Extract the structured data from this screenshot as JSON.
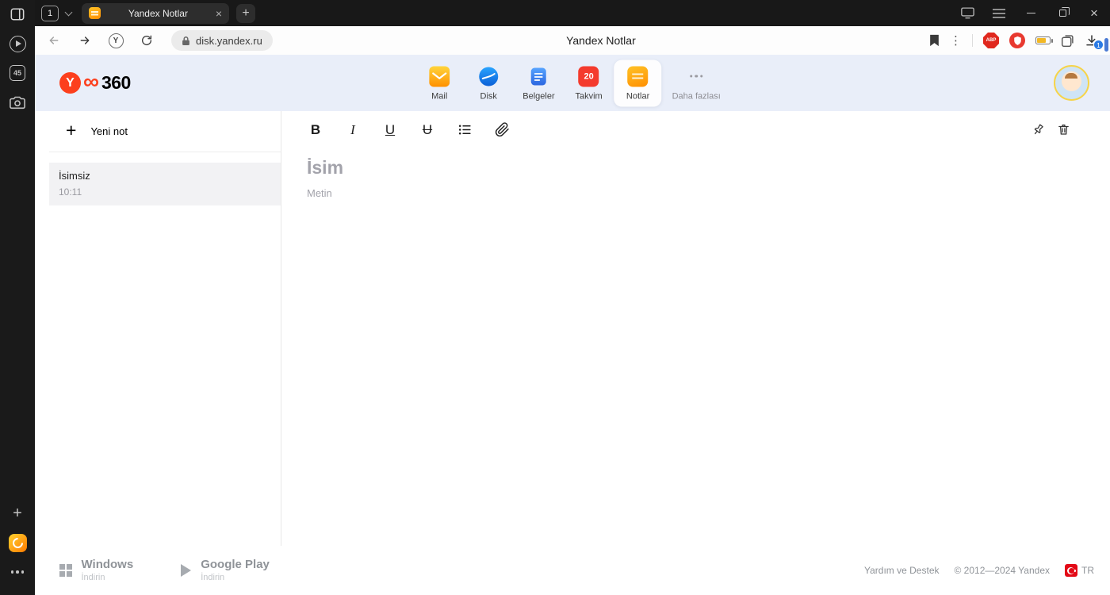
{
  "colors": {
    "yandex_red": "#fc3f1d",
    "header_bg": "#e9eef9",
    "notes_orange": "#ff9102",
    "accent_blue": "#2a7ae4",
    "chrome_dark": "#181818"
  },
  "side_strip": {
    "tabs_badge": "45"
  },
  "tab_bar": {
    "tab_count": "1",
    "tab_title": "Yandex Notlar"
  },
  "toolbar": {
    "url": "disk.yandex.ru",
    "page_title": "Yandex Notlar",
    "protect_letter": "Y",
    "abp_badge": "ABP",
    "download_badge": "1"
  },
  "header": {
    "logo_y": "Y",
    "logo_infinity": "∞",
    "logo_text": "360",
    "nav": [
      {
        "label": "Mail"
      },
      {
        "label": "Disk"
      },
      {
        "label": "Belgeler"
      },
      {
        "label": "Takvim",
        "badge": "20"
      },
      {
        "label": "Notlar"
      },
      {
        "label": "Daha fazlası"
      }
    ]
  },
  "notes": {
    "new_note_label": "Yeni not",
    "list": [
      {
        "title": "İsimsiz",
        "time": "10:11"
      }
    ],
    "format_toolbar": {
      "bold": "B",
      "italic": "I",
      "underline": "U",
      "strikethrough": "U"
    },
    "editor": {
      "title_placeholder": "İsim",
      "body_placeholder": "Metin"
    }
  },
  "footer": {
    "windows_title": "Windows",
    "windows_subtitle": "İndirin",
    "gplay_title": "Google Play",
    "gplay_subtitle": "İndirin",
    "help": "Yardım ve Destek",
    "copyright": "© 2012—2024 Yandex",
    "language": "TR"
  }
}
